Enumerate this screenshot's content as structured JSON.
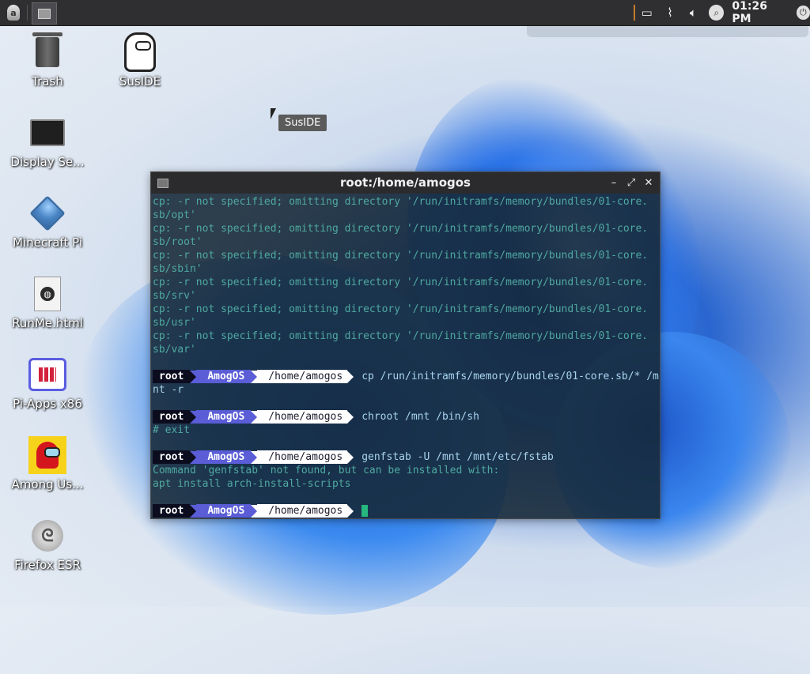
{
  "panel": {
    "clock": "01:26 PM"
  },
  "desktop": {
    "icons": [
      {
        "label": "Trash"
      },
      {
        "label": "SusIDE"
      },
      {
        "label": "Display Se..."
      },
      {
        "label": "Minecraft Pi"
      },
      {
        "label": "RunMe.html"
      },
      {
        "label": "Pi-Apps x86"
      },
      {
        "label": "Among Us..."
      },
      {
        "label": "Firefox ESR"
      }
    ],
    "tooltip": "SusIDE"
  },
  "terminal": {
    "title": "root:/home/amogos",
    "output_lines": [
      "cp: -r not specified; omitting directory '/run/initramfs/memory/bundles/01-core.",
      "sb/opt'",
      "cp: -r not specified; omitting directory '/run/initramfs/memory/bundles/01-core.",
      "sb/root'",
      "cp: -r not specified; omitting directory '/run/initramfs/memory/bundles/01-core.",
      "sb/sbin'",
      "cp: -r not specified; omitting directory '/run/initramfs/memory/bundles/01-core.",
      "sb/srv'",
      "cp: -r not specified; omitting directory '/run/initramfs/memory/bundles/01-core.",
      "sb/usr'",
      "cp: -r not specified; omitting directory '/run/initramfs/memory/bundles/01-core.",
      "sb/var'"
    ],
    "prompt": {
      "user": "root",
      "os": "AmogOS",
      "path": "/home/amogos"
    },
    "cmd1": "cp /run/initramfs/memory/bundles/01-core.sb/* /m",
    "cmd1_wrap": "nt -r",
    "cmd2": "chroot /mnt /bin/sh",
    "cmd2_out": "# exit",
    "cmd3": "genfstab -U /mnt /mnt/etc/fstab",
    "cmd3_out1": "Command 'genfstab' not found, but can be installed with:",
    "cmd3_out2": "apt install arch-install-scripts"
  }
}
